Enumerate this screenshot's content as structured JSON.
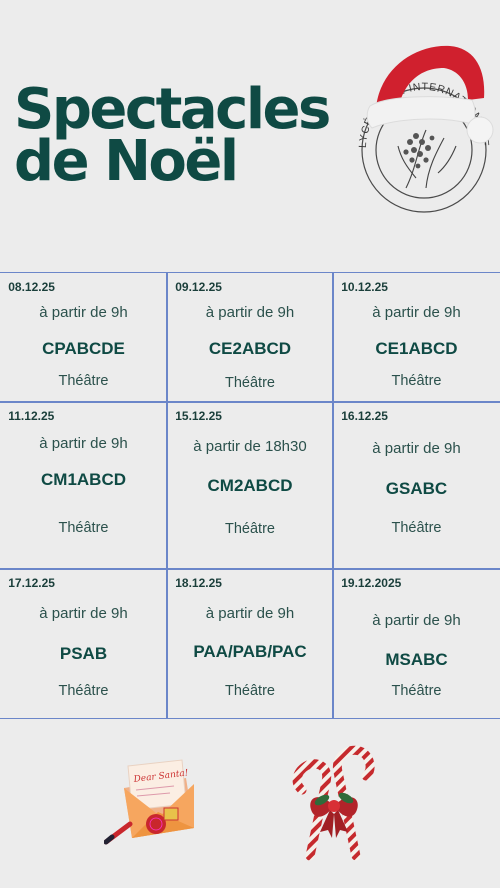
{
  "title": {
    "line1": "Spectacles",
    "line2": "de Noël"
  },
  "logo": {
    "text": "LYCÉE · THE INTERNATIONAL FRENCH SCHOOL"
  },
  "schedule": [
    {
      "date": "08.12.25",
      "time": "à partir de 9h",
      "classes": "CPABCDE",
      "venue": "Théâtre"
    },
    {
      "date": "09.12.25",
      "time": "à partir de 9h",
      "classes": "CE2ABCD",
      "venue": "Théâtre"
    },
    {
      "date": "10.12.25",
      "time": "à partir de 9h",
      "classes": "CE1ABCD",
      "venue": "Théâtre"
    },
    {
      "date": "11.12.25",
      "time": "à partir de 9h",
      "classes": "CM1ABCD",
      "venue": "Théâtre"
    },
    {
      "date": "15.12.25",
      "time": "à partir de 18h30",
      "classes": "CM2ABCD",
      "venue": "Théâtre"
    },
    {
      "date": "16.12.25",
      "time": "à partir de 9h",
      "classes": "GSABC",
      "venue": "Théâtre"
    },
    {
      "date": "17.12.25",
      "time": "à partir de 9h",
      "classes": "PSAB",
      "venue": "Théâtre"
    },
    {
      "date": "18.12.25",
      "time": "à partir de 9h",
      "classes": "PAA/PAB/PAC",
      "venue": "Théâtre"
    },
    {
      "date": "19.12.2025",
      "time": "à partir de 9h",
      "classes": "MSABC",
      "venue": "Théâtre"
    }
  ],
  "letter": {
    "text": "Dear Santa!"
  },
  "colors": {
    "title": "#0f4a44",
    "grid_border": "#6b86c9",
    "background": "#ececec",
    "hat_red": "#d0202e"
  }
}
